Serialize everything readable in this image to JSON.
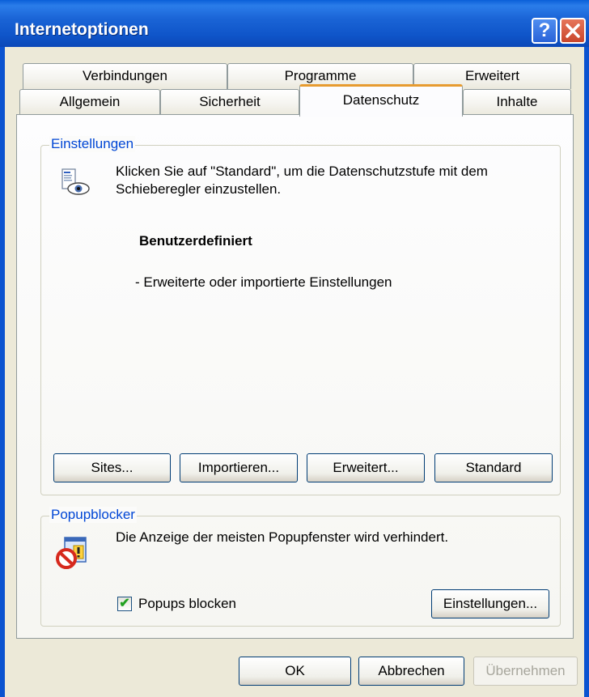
{
  "window": {
    "title": "Internetoptionen",
    "help_label": "?",
    "close_label": "✕"
  },
  "tabs": {
    "row_top": [
      "Verbindungen",
      "Programme",
      "Erweitert"
    ],
    "row_bottom": [
      "Allgemein",
      "Sicherheit",
      "Datenschutz",
      "Inhalte"
    ],
    "active": "Datenschutz"
  },
  "settings": {
    "legend": "Einstellungen",
    "icon": "privacy-eye-icon",
    "description_line1": "Klicken Sie auf \"Standard\", um die Datenschutzstufe mit dem",
    "description_line2": "Schieberegler einzustellen.",
    "level_title": "Benutzerdefiniert",
    "level_detail": "- Erweiterte oder importierte Einstellungen",
    "buttons": {
      "sites": "Sites...",
      "import": "Importieren...",
      "advanced": "Erweitert...",
      "default": "Standard"
    }
  },
  "popup": {
    "legend": "Popupblocker",
    "icon": "popup-blocked-icon",
    "description": "Die Anzeige der meisten Popupfenster wird verhindert.",
    "checkbox_label": "Popups blocken",
    "checkbox_checked": true,
    "settings_button": "Einstellungen..."
  },
  "footer": {
    "ok": "OK",
    "cancel": "Abbrechen",
    "apply": "Übernehmen"
  },
  "colors": {
    "titlebar": "#0b53d0",
    "group_legend": "#0046d5",
    "active_tab_accent": "#e79b2f"
  }
}
